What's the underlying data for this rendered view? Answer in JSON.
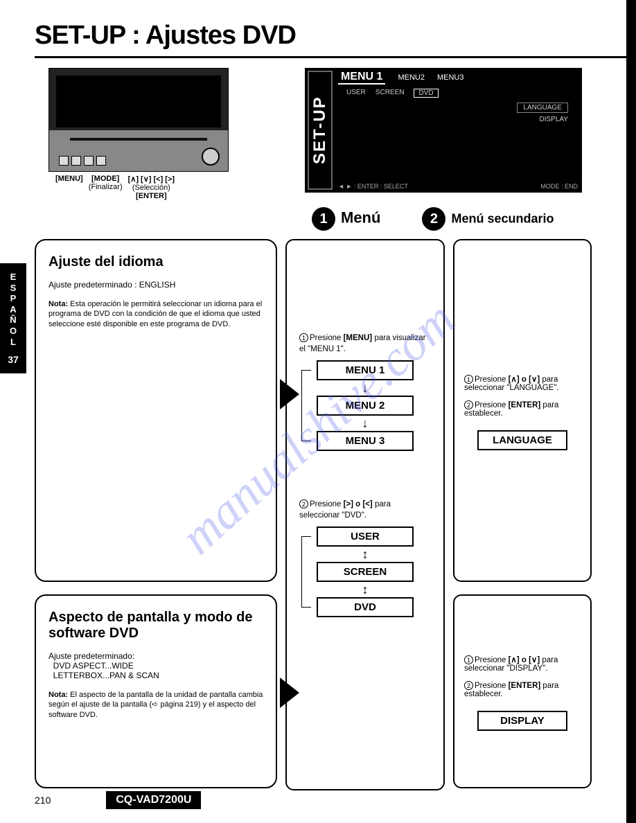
{
  "title": "SET-UP : Ajustes DVD",
  "device": {
    "menu_label": "[MENU]",
    "mode_label": "[MODE]",
    "mode_sub": "(Finalizar)",
    "arrows_label": "[∧] [∨] [<] [>]",
    "arrows_sub": "(Selección)",
    "enter_label": "[ENTER]"
  },
  "screen": {
    "setup": "SET-UP",
    "menu1": "MENU 1",
    "menu2": "MENU2",
    "menu3": "MENU3",
    "user": "USER",
    "screen_tab": "SCREEN",
    "dvd": "DVD",
    "language": "LANGUAGE",
    "display": "DISPLAY",
    "enter_select": "◄ ► : ENTER : SELECT",
    "mode_end": "MODE : END"
  },
  "steps": {
    "s1_label": "Menú",
    "s2_label": "Menú secundario"
  },
  "side_tab": {
    "lang": "ESPAÑOL",
    "page": "37"
  },
  "box1": {
    "heading": "Ajuste del idioma",
    "preset": "Ajuste predeterminado : ENGLISH",
    "note_label": "Nota:",
    "note_text": " Esta operación le permitirá seleccionar un idioma para el programa de DVD con la condición de que el idioma que usted seleccione esté disponible en este programa de DVD."
  },
  "box2": {
    "heading": "Aspecto de pantalla y modo de software DVD",
    "preset_label": "Ajuste predeterminado:",
    "preset_line1": "DVD ASPECT...WIDE",
    "preset_line2": "LETTERBOX...PAN & SCAN",
    "note_label": "Nota:",
    "note_text": " El aspecto de la pantalla de la unidad de pantalla cambia según el ajuste de la pantalla (➪ página 219) y el aspecto del software DVD."
  },
  "mid": {
    "step1_prefix": "Presione ",
    "step1_btn": "[MENU]",
    "step1_text": " para visualizar el \"MENU 1\".",
    "menu1": "MENU 1",
    "menu2": "MENU 2",
    "menu3": "MENU 3",
    "step2_prefix": "Presione ",
    "step2_btn": "[>] o [<]",
    "step2_text": " para seleccionar \"DVD\".",
    "user": "USER",
    "screen": "SCREEN",
    "dvd": "DVD"
  },
  "right1": {
    "step1_prefix": "Presione ",
    "step1_btn": "[∧] o [∨]",
    "step1_text": " para seleccionar \"LANGUAGE\".",
    "step2_prefix": "Presione ",
    "step2_btn": "[ENTER]",
    "step2_text": " para establecer.",
    "label": "LANGUAGE"
  },
  "right2": {
    "step1_prefix": "Presione ",
    "step1_btn": "[∧] o [∨]",
    "step1_text": " para seleccionar \"DISPLAY\".",
    "step2_prefix": "Presione ",
    "step2_btn": "[ENTER]",
    "step2_text": " para establecer.",
    "label": "DISPLAY"
  },
  "footer": {
    "page": "210",
    "model": "CQ-VAD7200U"
  },
  "watermark": "manualshive.com"
}
